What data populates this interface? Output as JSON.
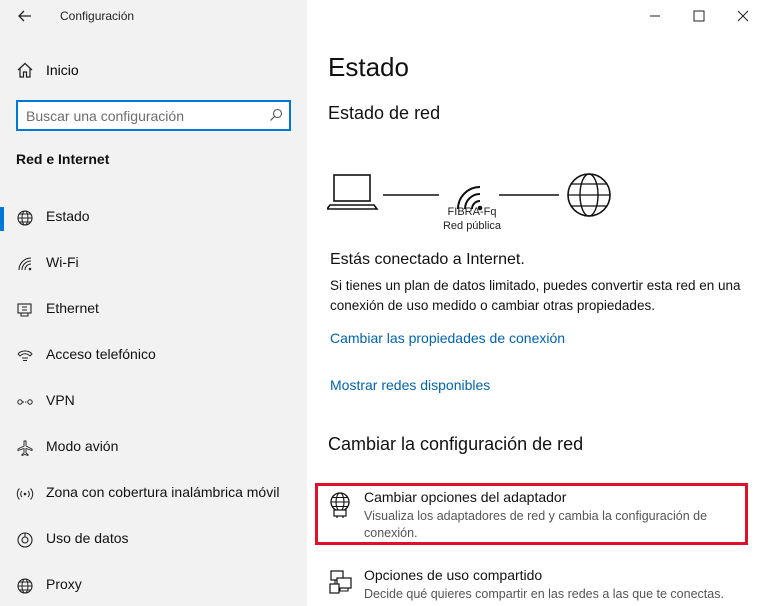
{
  "window": {
    "title": "Configuración",
    "minimize": "—",
    "maximize": "☐",
    "close": "✕"
  },
  "sidebar": {
    "home_label": "Inicio",
    "search_placeholder": "Buscar una configuración",
    "section_title": "Red e Internet",
    "items": [
      {
        "label": "Estado",
        "icon": "globe-icon",
        "selected": true
      },
      {
        "label": "Wi-Fi",
        "icon": "wifi-icon",
        "selected": false
      },
      {
        "label": "Ethernet",
        "icon": "ethernet-icon",
        "selected": false
      },
      {
        "label": "Acceso telefónico",
        "icon": "dialup-icon",
        "selected": false
      },
      {
        "label": "VPN",
        "icon": "vpn-icon",
        "selected": false
      },
      {
        "label": "Modo avión",
        "icon": "airplane-icon",
        "selected": false
      },
      {
        "label": "Zona con cobertura inalámbrica móvil",
        "icon": "hotspot-icon",
        "selected": false
      },
      {
        "label": "Uso de datos",
        "icon": "data-usage-icon",
        "selected": false
      },
      {
        "label": "Proxy",
        "icon": "globe-icon",
        "selected": false
      }
    ]
  },
  "main": {
    "title": "Estado",
    "network_status_heading": "Estado de red",
    "network": {
      "name": "FIBRA-Fq",
      "type": "Red pública"
    },
    "connected_text": "Estás conectado a Internet.",
    "description": "Si tienes un plan de datos limitado, puedes convertir esta red en una conexión de uso medido o cambiar otras propiedades.",
    "links": {
      "change_properties": "Cambiar las propiedades de conexión",
      "show_networks": "Mostrar redes disponibles"
    },
    "change_settings_heading": "Cambiar la configuración de red",
    "options": [
      {
        "title": "Cambiar opciones del adaptador",
        "subtitle": "Visualiza los adaptadores de red y cambia la configuración de conexión."
      },
      {
        "title": "Opciones de uso compartido",
        "subtitle": "Decide qué quieres compartir en las redes a las que te conectas."
      }
    ]
  },
  "colors": {
    "accent": "#0078d7",
    "link": "#0063b1",
    "highlight_box": "#e0102b",
    "sidebar_bg": "#f2f2f2"
  }
}
